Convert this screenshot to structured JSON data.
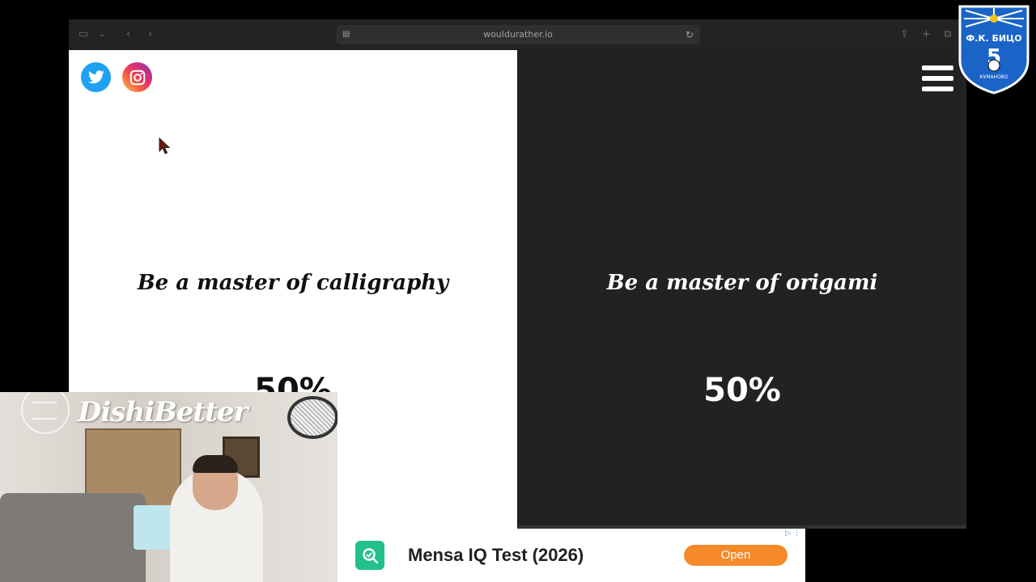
{
  "browser": {
    "url": "wouldurather.io",
    "icons": [
      "sidebar-icon",
      "chevron-down-icon",
      "back-icon",
      "forward-icon",
      "site-settings-icon",
      "reload-icon",
      "share-icon",
      "new-tab-icon",
      "tabs-overview-icon"
    ]
  },
  "question": {
    "option_a": {
      "text": "Be a master of calligraphy",
      "percent": "50%"
    },
    "option_b": {
      "text": "Be a master of origami",
      "percent": "50%"
    }
  },
  "social": [
    "twitter-icon",
    "instagram-icon"
  ],
  "overlay": {
    "channel_name": "DishiBetter",
    "club_badge": {
      "line1": "Ф.К. БИЦО",
      "number": "5",
      "line2": "КУМАНОВО"
    }
  },
  "ad": {
    "title": "Mensa IQ Test (2026)",
    "button_label": "Open",
    "accent": "#f6892a",
    "icon_color": "#22c08b"
  },
  "colors": {
    "left_pane": "#ffffff",
    "right_pane": "#222222",
    "twitter": "#1da1f2"
  }
}
